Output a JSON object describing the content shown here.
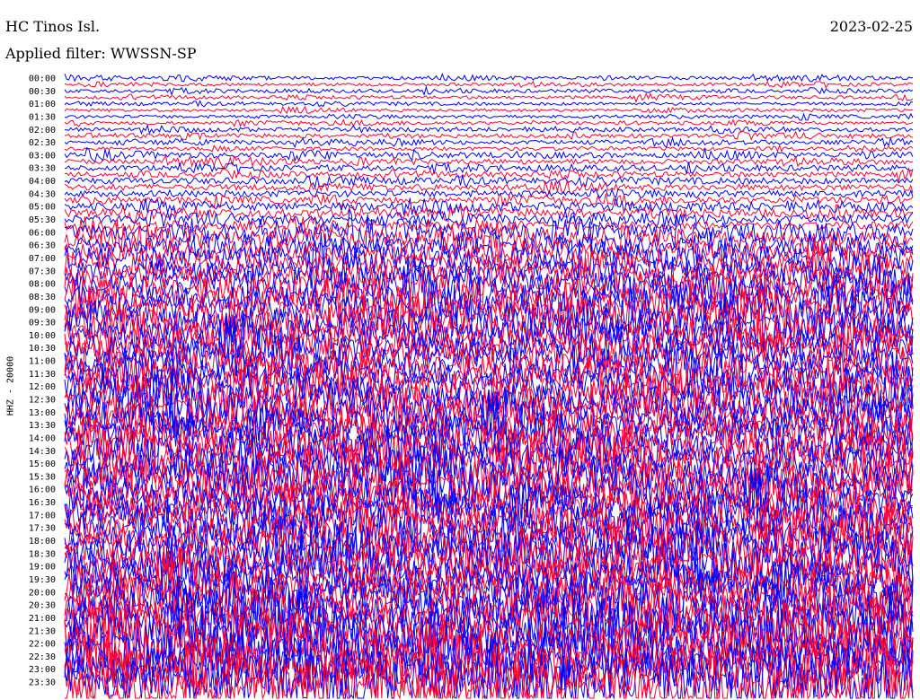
{
  "header": {
    "station": "HC Tinos Isl.",
    "date": "2023-02-25",
    "filter": "Applied filter: WWSSN-SP"
  },
  "chart_data": {
    "type": "line",
    "title": "HC Tinos Isl.",
    "subtitle": "Applied filter: WWSSN-SP",
    "date": "2023-02-25",
    "ylabel": "HHZ - 20000",
    "xlabel": "",
    "colors": [
      "#0000ff",
      "#ff0033"
    ],
    "traces_per_hour": 4,
    "duration_minutes_per_trace": 15,
    "row_labels": [
      "00:00",
      "00:30",
      "01:00",
      "01:30",
      "02:00",
      "02:30",
      "03:00",
      "03:30",
      "04:00",
      "04:30",
      "05:00",
      "05:30",
      "06:00",
      "06:30",
      "07:00",
      "07:30",
      "08:00",
      "08:30",
      "09:00",
      "09:30",
      "10:00",
      "10:30",
      "11:00",
      "11:30",
      "12:00",
      "12:30",
      "13:00",
      "13:30",
      "14:00",
      "14:30",
      "15:00",
      "15:30",
      "16:00",
      "16:30",
      "17:00",
      "17:30",
      "18:00",
      "18:30",
      "19:00",
      "19:30",
      "20:00",
      "20:30",
      "21:00",
      "21:30",
      "22:00",
      "22:30",
      "23:00",
      "23:30"
    ],
    "relative_amplitude_by_hour": [
      1,
      1,
      1.2,
      1.6,
      2,
      2.6,
      5,
      7,
      8,
      9,
      9,
      8,
      9.5,
      9.5,
      10,
      10,
      10,
      10,
      10,
      10.5,
      11,
      12,
      13,
      14
    ],
    "grid": false
  }
}
